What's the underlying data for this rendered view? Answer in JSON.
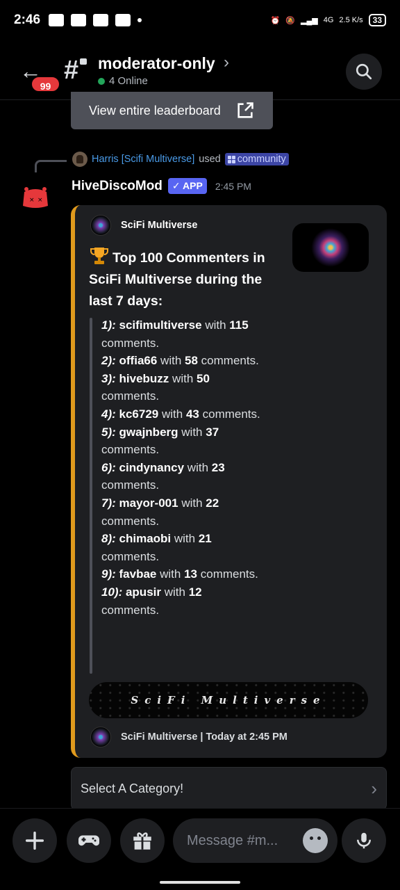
{
  "status_bar": {
    "time": "2:46",
    "network": "4G",
    "speed": "2.5 K/s",
    "battery": "33"
  },
  "header": {
    "back_badge": "99",
    "channel_name": "moderator-only",
    "chevron": "›",
    "online": "4 Online"
  },
  "leaderboard_button": {
    "label": "View entire leaderboard"
  },
  "reply": {
    "user": "Harris [Scifi Multiverse]",
    "verb": "used",
    "command": "community"
  },
  "message": {
    "author": "HiveDiscoMod",
    "app_tag": "✓ APP",
    "time": "2:45 PM",
    "embed": {
      "author": "SciFi Multiverse",
      "title": "Top 100 Commenters in SciFi Multiverse during the last 7 days:",
      "banner_text": "SciFi Multiverse",
      "footer": "SciFi Multiverse | Today at 2:45 PM",
      "accent_color": "#e09a1d",
      "entries": [
        {
          "rank": "1):",
          "user": "scifimultiverse",
          "count": "115"
        },
        {
          "rank": "2):",
          "user": "offia66",
          "count": "58"
        },
        {
          "rank": "3):",
          "user": "hivebuzz",
          "count": "50"
        },
        {
          "rank": "4):",
          "user": "kc6729",
          "count": "43"
        },
        {
          "rank": "5):",
          "user": "gwajnberg",
          "count": "37"
        },
        {
          "rank": "6):",
          "user": "cindynancy",
          "count": "23"
        },
        {
          "rank": "7):",
          "user": "mayor-001",
          "count": "22"
        },
        {
          "rank": "8):",
          "user": "chimaobi",
          "count": "21"
        },
        {
          "rank": "9):",
          "user": "favbae",
          "count": "13"
        },
        {
          "rank": "10):",
          "user": "apusir",
          "count": "12"
        }
      ],
      "with_word": "with",
      "comments_word": "comments."
    }
  },
  "select": {
    "placeholder": "Select A Category!"
  },
  "composer": {
    "placeholder": "Message #m..."
  },
  "colors": {
    "brand": "#5865f2",
    "online": "#23a55a",
    "badge": "#e5383b"
  }
}
